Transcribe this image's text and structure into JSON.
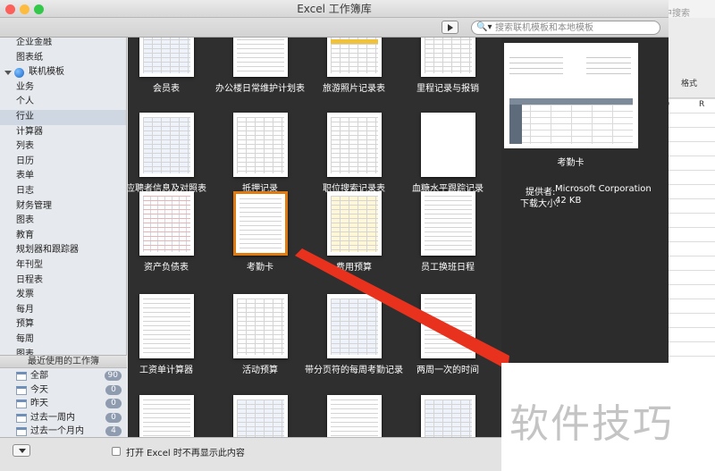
{
  "window": {
    "title": "Excel 工作簿库"
  },
  "search": {
    "placeholder": "搜索联机模板和本地模板"
  },
  "background": {
    "search_hint": "中搜索",
    "format_label": "格式",
    "col_q": "Q",
    "col_r": "R"
  },
  "sidebar": {
    "items": [
      {
        "label": "企业金融"
      },
      {
        "label": "图表纸"
      },
      {
        "label": "联机模板",
        "icon": "globe-icon",
        "expanded": true
      },
      {
        "label": "业务"
      },
      {
        "label": "个人"
      },
      {
        "label": "行业",
        "selected": true
      },
      {
        "label": "计算器"
      },
      {
        "label": "列表"
      },
      {
        "label": "日历"
      },
      {
        "label": "表单"
      },
      {
        "label": "日志"
      },
      {
        "label": "财务管理"
      },
      {
        "label": "图表"
      },
      {
        "label": "教育"
      },
      {
        "label": "规划器和跟踪器"
      },
      {
        "label": "年刊型"
      },
      {
        "label": "日程表"
      },
      {
        "label": "发票"
      },
      {
        "label": "每月"
      },
      {
        "label": "预算"
      },
      {
        "label": "每周"
      },
      {
        "label": "图表"
      }
    ]
  },
  "recent": {
    "heading": "最近使用的工作簿",
    "rows": [
      {
        "label": "全部",
        "count": "90"
      },
      {
        "label": "今天",
        "count": "0"
      },
      {
        "label": "昨天",
        "count": "0"
      },
      {
        "label": "过去一周内",
        "count": "0"
      },
      {
        "label": "过去一个月内",
        "count": "4"
      }
    ]
  },
  "gallery": {
    "rows": [
      [
        "会员表",
        "办公楼日常维护计划表",
        "旅游照片记录表",
        "里程记录与报销"
      ],
      [
        "应聘者信息及对照表",
        "抵押记录",
        "职位搜索记录表",
        "血糖水平跟踪记录"
      ],
      [
        "资产负债表",
        "考勤卡",
        "费用预算",
        "员工换班日程"
      ],
      [
        "工资单计算器",
        "活动预算",
        "带分页符的每周考勤记录",
        "两周一次的时间"
      ]
    ],
    "selected": "考勤卡"
  },
  "preview": {
    "name": "考勤卡",
    "provider_label": "提供者:",
    "provider": "Microsoft Corporation",
    "size_label": "下载大小:",
    "size": "42 KB"
  },
  "footer": {
    "checkbox_label": "打开 Excel 时不再显示此内容",
    "checked": false
  },
  "watermark": "软件技巧",
  "colors": {
    "arrow": "#e8321e",
    "selection": "#e07b12",
    "gallery_bg": "#2f2f2f"
  }
}
